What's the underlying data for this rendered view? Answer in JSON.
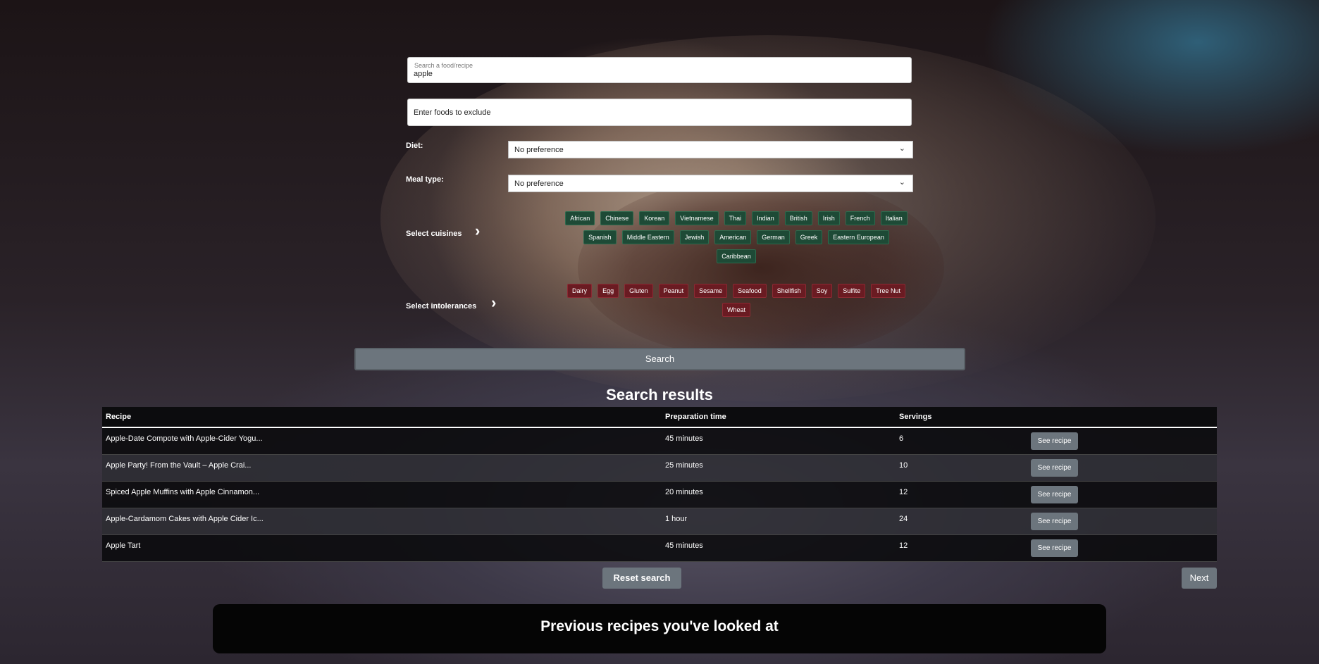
{
  "search": {
    "label": "Search a food/recipe",
    "value": "apple",
    "exclude_placeholder": "Enter foods to exclude"
  },
  "diet": {
    "label": "Diet:",
    "selected": "No preference"
  },
  "meal_type": {
    "label": "Meal type:",
    "selected": "No preference"
  },
  "cuisines": {
    "label": "Select cuisines",
    "items": [
      "African",
      "Chinese",
      "Korean",
      "Vietnamese",
      "Thai",
      "Indian",
      "British",
      "Irish",
      "French",
      "Italian",
      "Spanish",
      "Middle Eastern",
      "Jewish",
      "American",
      "German",
      "Greek",
      "Eastern European",
      "Caribbean"
    ]
  },
  "intolerances": {
    "label": "Select intolerances",
    "items": [
      "Dairy",
      "Egg",
      "Gluten",
      "Peanut",
      "Sesame",
      "Seafood",
      "Shellfish",
      "Soy",
      "Sulfite",
      "Tree Nut",
      "Wheat"
    ]
  },
  "search_button": "Search",
  "results": {
    "title": "Search results",
    "columns": [
      "Recipe",
      "Preparation time",
      "Servings"
    ],
    "rows": [
      {
        "recipe": "Apple-Date Compote with Apple-Cider Yogu...",
        "time": "45 minutes",
        "servings": "6",
        "action": "See recipe"
      },
      {
        "recipe": "Apple Party! From the Vault – Apple Crai...",
        "time": "25 minutes",
        "servings": "10",
        "action": "See recipe"
      },
      {
        "recipe": "Spiced Apple Muffins with Apple Cinnamon...",
        "time": "20 minutes",
        "servings": "12",
        "action": "See recipe"
      },
      {
        "recipe": "Apple-Cardamom Cakes with Apple Cider Ic...",
        "time": "1 hour",
        "servings": "24",
        "action": "See recipe"
      },
      {
        "recipe": "Apple Tart",
        "time": "45 minutes",
        "servings": "12",
        "action": "See recipe"
      }
    ]
  },
  "reset_button": "Reset search",
  "next_button": "Next",
  "previous": {
    "title": "Previous recipes you've looked at"
  },
  "colors": {
    "cuisine_chip": "#1e4a36",
    "intolerance_chip": "#6a1b22",
    "button": "#6c757d"
  }
}
